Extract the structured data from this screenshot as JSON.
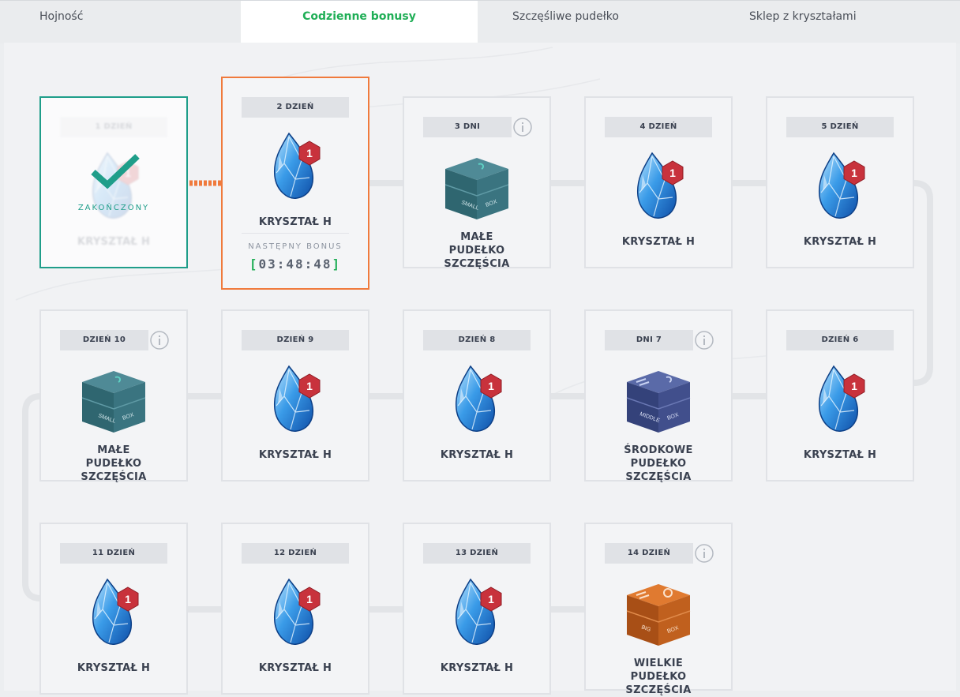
{
  "tabs": [
    {
      "label": "Hojność"
    },
    {
      "label": "Codzienne bonusy"
    },
    {
      "label": "Szczęśliwe pudełko"
    },
    {
      "label": "Sklep z kryształami"
    }
  ],
  "colors": {
    "active_tab": "#1fae56",
    "completed": "#1f9e8a",
    "current": "#f07a3c"
  },
  "days": [
    {
      "day": "1 DZIEŃ",
      "reward": "KRYSZTAŁ H",
      "status": "ZAKOŃCZONY",
      "icon": "crystal-icon"
    },
    {
      "day": "2 DZIEŃ",
      "reward": "KRYSZTAŁ H",
      "badge": "1",
      "icon": "crystal-icon",
      "next_label": "NASTĘPNY BONUS",
      "timer": "03:48:48"
    },
    {
      "day": "3 DNI",
      "reward": "MAŁE PUDEŁKO SZCZĘŚCIA",
      "icon": "small-box-icon",
      "box_text": [
        "SMALL",
        "BOX"
      ]
    },
    {
      "day": "4 DZIEŃ",
      "reward": "KRYSZTAŁ H",
      "badge": "1",
      "icon": "crystal-icon"
    },
    {
      "day": "5 DZIEŃ",
      "reward": "KRYSZTAŁ H",
      "badge": "1",
      "icon": "crystal-icon"
    },
    {
      "day": "DZIEŃ 6",
      "reward": "KRYSZTAŁ H",
      "badge": "1",
      "icon": "crystal-icon"
    },
    {
      "day": "DNI 7",
      "reward": "ŚRODKOWE PUDEŁKO SZCZĘŚCIA",
      "icon": "middle-box-icon",
      "box_text": [
        "MIDDLE",
        "BOX"
      ]
    },
    {
      "day": "DZIEŃ 8",
      "reward": "KRYSZTAŁ H",
      "badge": "1",
      "icon": "crystal-icon"
    },
    {
      "day": "DZIEŃ 9",
      "reward": "KRYSZTAŁ H",
      "badge": "1",
      "icon": "crystal-icon"
    },
    {
      "day": "DZIEŃ 10",
      "reward": "MAŁE PUDEŁKO SZCZĘŚCIA",
      "icon": "small-box-icon",
      "box_text": [
        "SMALL",
        "BOX"
      ]
    },
    {
      "day": "11 DZIEŃ",
      "reward": "KRYSZTAŁ H",
      "badge": "1",
      "icon": "crystal-icon"
    },
    {
      "day": "12 DZIEŃ",
      "reward": "KRYSZTAŁ H",
      "badge": "1",
      "icon": "crystal-icon"
    },
    {
      "day": "13 DZIEŃ",
      "reward": "KRYSZTAŁ H",
      "badge": "1",
      "icon": "crystal-icon"
    },
    {
      "day": "14 DZIEŃ",
      "reward": "WIELKIE PUDEŁKO SZCZĘŚCIA",
      "icon": "big-box-icon",
      "box_text": [
        "BIG",
        "BOX"
      ]
    }
  ]
}
